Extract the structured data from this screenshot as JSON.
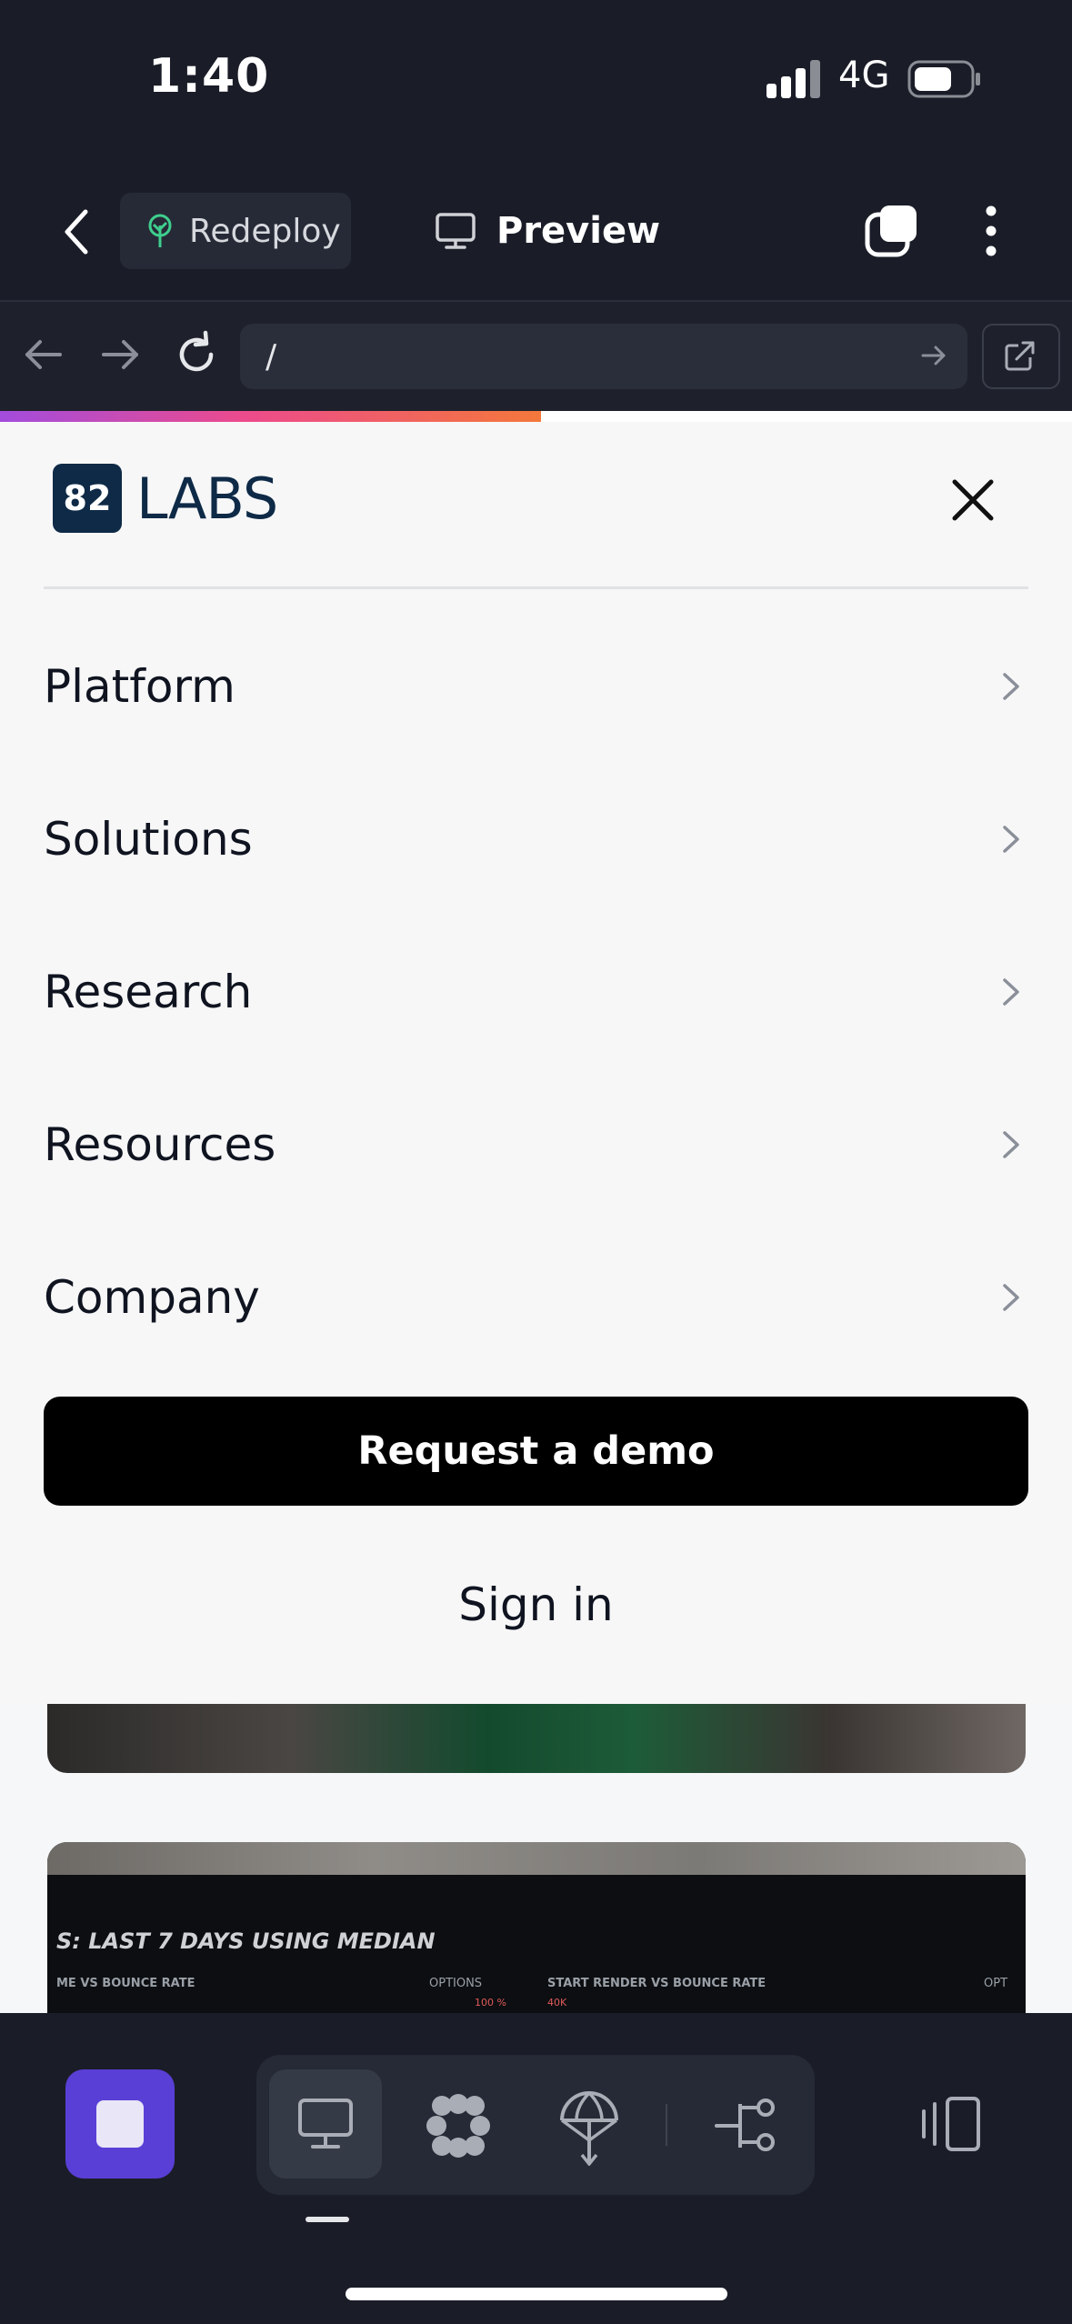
{
  "status_bar": {
    "time": "1:40",
    "network": "4G"
  },
  "app_toolbar": {
    "redeploy_label": "Redeploy",
    "preview_label": "Preview"
  },
  "browser": {
    "url": "/",
    "load_progress": 0.505
  },
  "site": {
    "logo_number": "82",
    "logo_text": "LABS",
    "menu_items": [
      {
        "label": "Platform"
      },
      {
        "label": "Solutions"
      },
      {
        "label": "Research"
      },
      {
        "label": "Resources"
      },
      {
        "label": "Company"
      }
    ],
    "cta_label": "Request a demo",
    "signin_label": "Sign in"
  },
  "background_card": {
    "heading": "S: LAST 7 DAYS USING MEDIAN",
    "left_chart_label": "ME VS BOUNCE RATE",
    "left_options": "OPTIONS",
    "left_value": "100 %",
    "right_chart_label": "START RENDER VS BOUNCE RATE",
    "right_options": "OPT",
    "right_value": "40K"
  },
  "colors": {
    "accent_purple": "#5a3fd6",
    "progress_start": "#a34cdd",
    "progress_mid": "#ec4b8c",
    "progress_end": "#f4783b",
    "logo_navy": "#0e2a47"
  },
  "icons": {
    "back": "chevron-left-icon",
    "redeploy": "tree-icon",
    "preview": "monitor-icon",
    "copy": "copy-icon",
    "more": "kebab-icon",
    "close": "close-icon",
    "menu_chevron": "chevron-right-icon",
    "stop": "stop-icon",
    "desktop": "monitor-icon",
    "flower": "flower-icon",
    "deploy": "parachute-icon",
    "branch": "branch-icon",
    "panels": "panels-icon"
  }
}
